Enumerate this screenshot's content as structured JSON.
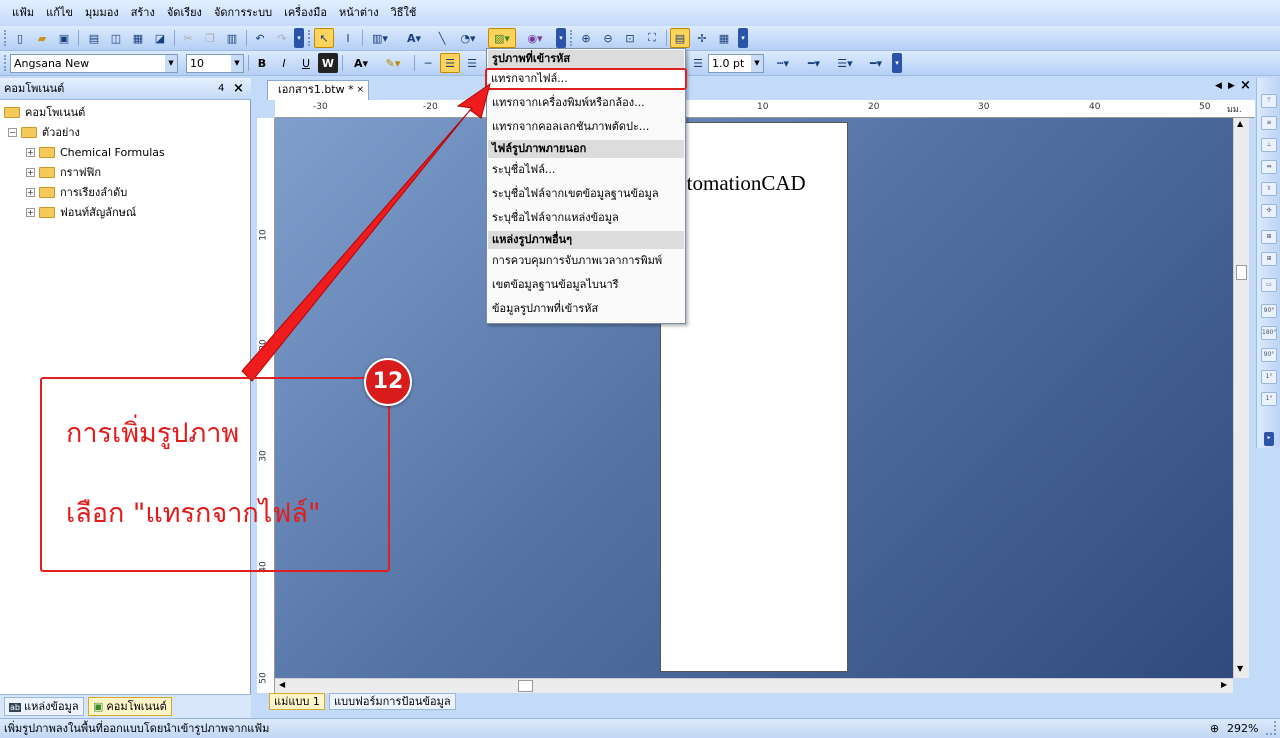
{
  "menubar": {
    "items": [
      "แฟ้ม",
      "แก้ไข",
      "มุมมอง",
      "สร้าง",
      "จัดเรียง",
      "จัดการระบบ",
      "เครื่องมือ",
      "หน้าต่าง",
      "วิธีใช้"
    ]
  },
  "toolbar": {
    "font_name": "Angsana New",
    "font_size": "10",
    "bold_label": "B",
    "italic_label": "I",
    "underline_label": "U",
    "word_label": "W",
    "font_color_label": "A",
    "line_width": "1.0 pt"
  },
  "panel": {
    "title": "คอมโพเนนต์",
    "pin_label": "4",
    "close_label": "×",
    "root": "คอมโพเนนต์",
    "examples": "ตัวอย่าง",
    "children": [
      "Chemical Formulas",
      "กราฟฟิก",
      "การเรียงลำดับ",
      "ฟอนท์สัญลักษณ์"
    ],
    "tabs": [
      "แหล่งข้อมูล",
      "คอมโพเนนต์"
    ]
  },
  "document": {
    "tab_title": "เอกสาร1.btw *",
    "page_text": "AutomationCAD",
    "ruler_h": [
      "-30",
      "-20",
      "10",
      "20",
      "30",
      "40",
      "50",
      "มม."
    ],
    "ruler_v": [
      "10",
      "20",
      "30",
      "40",
      "50"
    ],
    "layout_tabs": [
      "แม่แบบ 1",
      "แบบฟอร์มการป้อนข้อมูล"
    ]
  },
  "dropdown": {
    "section1": "รูปภาพที่เข้ารหัส",
    "items1": [
      "แทรกจากไฟล์...",
      "แทรกจากเครื่องพิมพ์หรือกล้อง...",
      "แทรกจากคอลเลกชันภาพตัดปะ..."
    ],
    "section2": "ไฟล์รูปภาพภายนอก",
    "items2": [
      "ระบุชื่อไฟล์...",
      "ระบุชื่อไฟล์จากเขตข้อมูลฐานข้อมูล",
      "ระบุชื่อไฟล์จากแหล่งข้อมูล"
    ],
    "section3": "แหล่งรูปภาพอื่นๆ",
    "items3": [
      "การควบคุมการจับภาพเวลาการพิมพ์",
      "เขตข้อมูลฐานข้อมูลไบนารี",
      "ข้อมูลรูปภาพที่เข้ารหัส"
    ]
  },
  "annotation": {
    "step_number": "12",
    "line1": "การเพิ่มรูปภาพ",
    "line2": "เลือก \"แทรกจากไฟล์\""
  },
  "status": {
    "message": "เพิ่มรูปภาพลงในพื้นที่ออกแบบโดยนำเข้ารูปภาพจากแฟ้ม",
    "zoom": "292%"
  },
  "colors": {
    "annotation_red": "#e41b1b",
    "highlight_yellow": "#ffd35c"
  }
}
